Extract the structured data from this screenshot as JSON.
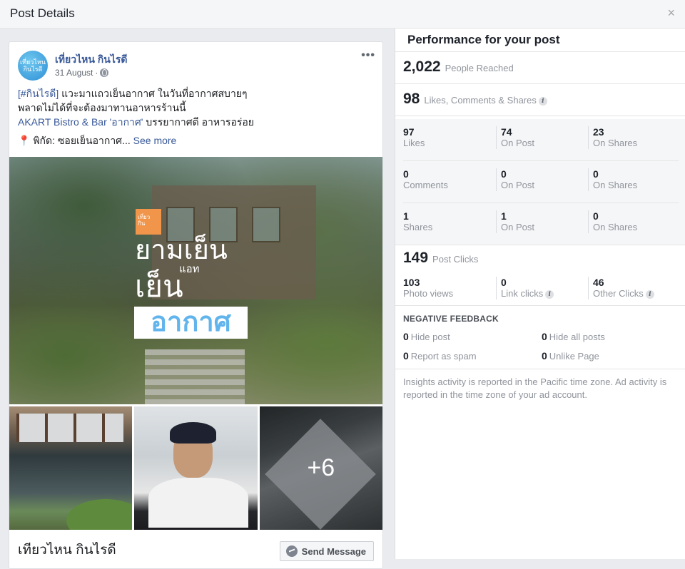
{
  "header": {
    "title": "Post Details",
    "close_icon": "×"
  },
  "post": {
    "page_name": "เที่ยวไหน กินไรดี",
    "avatar_text_top": "เที่ยวไหน",
    "avatar_text_bottom": "กินไรดี",
    "date": "31 August",
    "meta_separator": "·",
    "privacy_icon": "globe-icon",
    "more_label": "•••",
    "text": {
      "hashtag": "[#กินไรดี]",
      "line1_rest": " แวะมาแถวเย็นอากาศ ในวันที่อากาศสบายๆ",
      "line2": "พลาดไม่ได้ที่จะต้องมาทานอาหารร้านนี้",
      "line3_link": "AKART Bistro & Bar 'อากาศ'",
      "line3_rest": " บรรยากาศดี อาหารอร่อย",
      "pin_icon": "📍",
      "line4": " พิกัด: ซอยเย็นอากาศ...",
      "see_more": "See more"
    },
    "main_photo": {
      "logo_text_top": "เที่ยว",
      "logo_text_bottom": "กิน",
      "title_line1": "ยามเย็น",
      "title_small": "แอท",
      "title_line2": "เย็น",
      "title_boxed": "อากาศ"
    },
    "extra_photos_count": "+6",
    "footer_page_name": "เทียวไหน กินไรดี",
    "send_message_label": "Send Message"
  },
  "performance": {
    "title": "Performance for your post",
    "people_reached": {
      "value": "2,022",
      "label": "People Reached"
    },
    "engagement": {
      "value": "98",
      "label": "Likes, Comments & Shares"
    },
    "info_glyph": "i",
    "breakdown": [
      {
        "total": {
          "value": "97",
          "label": "Likes"
        },
        "on_post": {
          "value": "74",
          "label": "On Post"
        },
        "on_shares": {
          "value": "23",
          "label": "On Shares"
        }
      },
      {
        "total": {
          "value": "0",
          "label": "Comments"
        },
        "on_post": {
          "value": "0",
          "label": "On Post"
        },
        "on_shares": {
          "value": "0",
          "label": "On Shares"
        }
      },
      {
        "total": {
          "value": "1",
          "label": "Shares"
        },
        "on_post": {
          "value": "1",
          "label": "On Post"
        },
        "on_shares": {
          "value": "0",
          "label": "On Shares"
        }
      }
    ],
    "post_clicks": {
      "value": "149",
      "label": "Post Clicks"
    },
    "clicks_breakdown": {
      "photo_views": {
        "value": "103",
        "label": "Photo views"
      },
      "link_clicks": {
        "value": "0",
        "label": "Link clicks"
      },
      "other_clicks": {
        "value": "46",
        "label": "Other Clicks"
      }
    },
    "negative_feedback": {
      "title": "NEGATIVE FEEDBACK",
      "hide_post": {
        "value": "0",
        "label": "Hide post"
      },
      "hide_all_posts": {
        "value": "0",
        "label": "Hide all posts"
      },
      "report_spam": {
        "value": "0",
        "label": "Report as spam"
      },
      "unlike_page": {
        "value": "0",
        "label": "Unlike Page"
      }
    },
    "disclaimer": "Insights activity is reported in the Pacific time zone. Ad activity is reported in the time zone of your ad account."
  }
}
